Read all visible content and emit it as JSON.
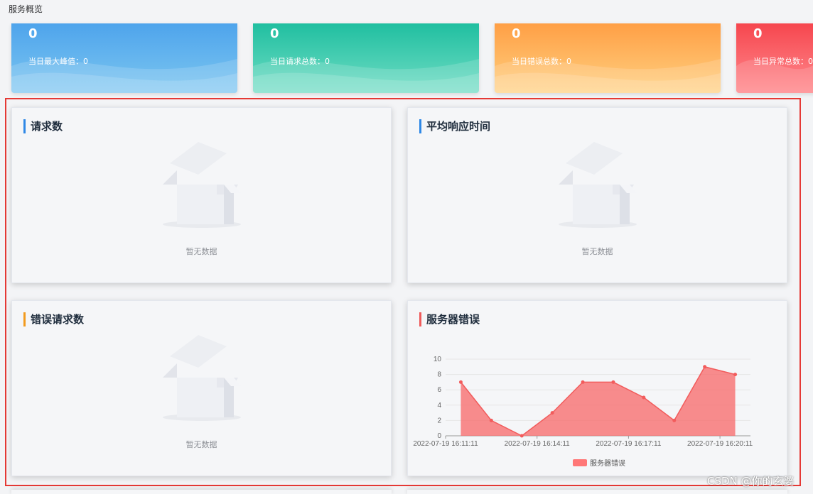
{
  "page": {
    "title": "服务概览"
  },
  "stats": [
    {
      "value": "0",
      "label": "当日最大峰值：",
      "num": "0",
      "color": "#4ea4ec"
    },
    {
      "value": "0",
      "label": "当日请求总数：",
      "num": "0",
      "color": "#20bfa0"
    },
    {
      "value": "0",
      "label": "当日错误总数：",
      "num": "0",
      "color": "#ff9f45"
    },
    {
      "value": "0",
      "label": "当日异常总数：",
      "num": "0",
      "color": "#f6464e"
    }
  ],
  "panels": {
    "requests": {
      "title": "请求数",
      "empty_text": "暂无数据"
    },
    "avg_response": {
      "title": "平均响应时间",
      "empty_text": "暂无数据"
    },
    "error_requests": {
      "title": "错误请求数",
      "empty_text": "暂无数据"
    },
    "server_errors": {
      "title": "服务器错误",
      "legend": "服务器错误"
    }
  },
  "chart_data": {
    "type": "area",
    "x": [
      "2022-07-19 16:11:11",
      "2022-07-19 16:12:11",
      "2022-07-19 16:13:11",
      "2022-07-19 16:14:11",
      "2022-07-19 16:15:11",
      "2022-07-19 16:16:11",
      "2022-07-19 16:17:11",
      "2022-07-19 16:18:11",
      "2022-07-19 16:19:11",
      "2022-07-19 16:20:11"
    ],
    "x_tick_labels": [
      "2022-07-19 16:11:11",
      "2022-07-19 16:14:11",
      "2022-07-19 16:17:11",
      "2022-07-19 16:20:11"
    ],
    "series": [
      {
        "name": "服务器错误",
        "values": [
          7,
          2,
          0,
          3,
          7,
          7,
          5,
          2,
          9,
          8
        ]
      }
    ],
    "y_ticks": [
      0,
      2,
      4,
      6,
      8,
      10
    ],
    "ylim": [
      0,
      10
    ],
    "color": "#f77070",
    "grid": true,
    "legend": "bottom-center"
  },
  "watermark": "CSDN @你的玄婆"
}
